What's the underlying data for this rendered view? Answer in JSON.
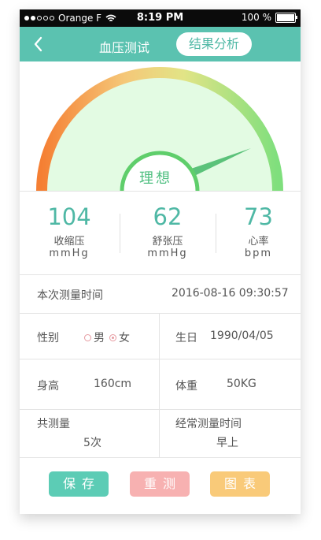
{
  "status_bar": {
    "carrier": "Orange F",
    "time": "8:19 PM",
    "battery_percent": "100 %",
    "battery_level": 1.0,
    "signal_bars_filled": 2,
    "signal_bars_total": 5
  },
  "nav": {
    "title": "血压测试",
    "active_tab": "结果分析",
    "back_icon": "chevron-left-icon"
  },
  "gauge": {
    "label": "理想",
    "colors": {
      "start": "#f57f33",
      "mid": "#f5d88a",
      "end": "#7fdf7d",
      "inner": "#e3fbe3",
      "label_ring": "#5fce6b"
    }
  },
  "readings": [
    {
      "value": "104",
      "label": "收缩压",
      "unit": "mmHg"
    },
    {
      "value": "62",
      "label": "舒张压",
      "unit": "mmHg"
    },
    {
      "value": "73",
      "label": "心率",
      "unit": "bpm"
    }
  ],
  "info": {
    "measure_time_label": "本次测量时间",
    "measure_time_value": "2016-08-16  09:30:57",
    "gender_label": "性别",
    "gender_options": [
      "男",
      "女"
    ],
    "gender_selected": "女",
    "birthday_label": "生日",
    "birthday_value": "1990/04/05",
    "height_label": "身高",
    "height_value": "160cm",
    "weight_label": "体重",
    "weight_value": "50KG",
    "count_label": "共测量",
    "count_value": "5次",
    "usual_time_label": "经常测量时间",
    "usual_time_value": "早上"
  },
  "buttons": {
    "save": "保存",
    "retest": "重测",
    "chart": "图表"
  },
  "colors": {
    "primary": "#5bc2b0",
    "value_text": "#4fb8a5",
    "save": "#5cccb5",
    "retest": "#f7b1b1",
    "chart": "#f9ca79"
  }
}
